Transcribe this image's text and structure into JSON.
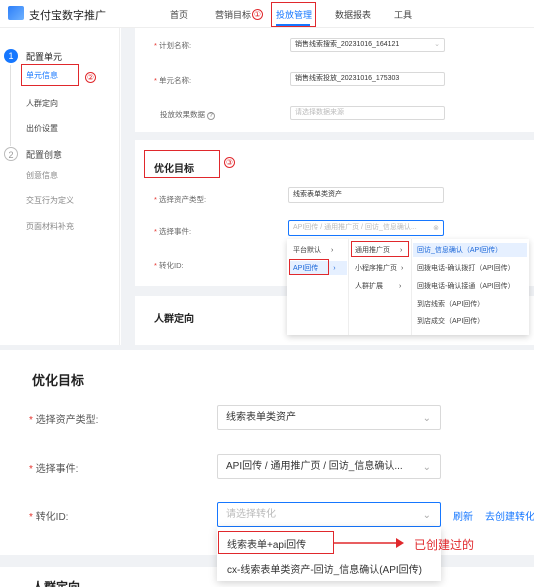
{
  "top_window": {
    "brand": "支付宝数字推广",
    "nav": [
      "首页",
      "营销目标",
      "投放管理",
      "数据报表",
      "工具"
    ],
    "steps": [
      {
        "num": "1",
        "title": "配置单元",
        "items": [
          "单元信息",
          "人群定向",
          "出价设置"
        ]
      },
      {
        "num": "2",
        "title": "配置创意",
        "items": [
          "创意信息",
          "交互行为定义",
          "页面材料补充"
        ]
      }
    ],
    "form": {
      "plan_label": "计划名称:",
      "plan_value": "销售线索搜索_20231016_164121",
      "unit_label": "单元名称:",
      "unit_value": "销售线索投放_20231016_175303",
      "effect_label": "投放效果数据",
      "effect_placeholder": "请选择数据来源"
    },
    "opt_goal_title": "优化目标",
    "asset_label": "选择资产类型:",
    "asset_value": "线索表单类资产",
    "event_label": "选择事件:",
    "event_value": "API回传 / 通用推广页 / 回访_信息确认...",
    "conv_label": "转化ID:",
    "crowd_title": "人群定向",
    "cascade": {
      "col1": [
        "平台默认",
        "API回传"
      ],
      "col2": [
        "通用推广页",
        "小程序推广页",
        "人群扩展"
      ],
      "col3": [
        "回访_信息确认（API回传）",
        "回拨电话-确认拨打（API回传）",
        "回拨电话-确认接通（API回传）",
        "到店线索（API回传）",
        "到店成交（API回传）"
      ]
    }
  },
  "bottom_window": {
    "title": "优化目标",
    "asset_label": "选择资产类型:",
    "asset_value": "线索表单类资产",
    "event_label": "选择事件:",
    "event_value": "API回传 / 通用推广页 / 回访_信息确认...",
    "conv_label": "转化ID:",
    "conv_placeholder": "请选择转化",
    "refresh": "刷新",
    "create": "去创建转化",
    "options": [
      "线索表单+api回传",
      "cx-线索表单类资产-回访_信息确认(API回传)"
    ],
    "crowd_title": "人群定向"
  },
  "annotations": {
    "created_note": "已创建过的",
    "marks": [
      "①",
      "②",
      "③"
    ]
  },
  "colors": {
    "annotation_red": "#e0282c",
    "primary_blue": "#1677ff",
    "required_star": "#e5332d"
  }
}
